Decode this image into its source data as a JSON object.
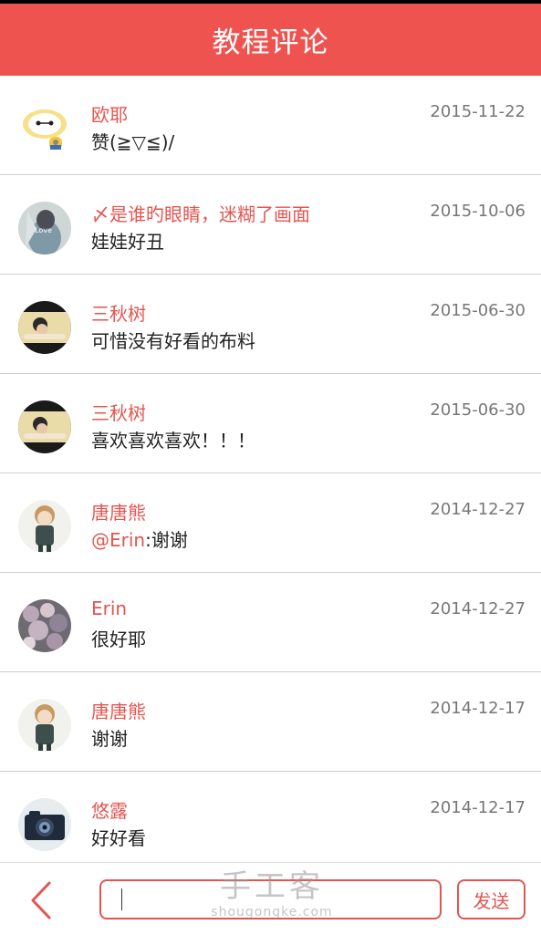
{
  "header": {
    "title": "教程评论"
  },
  "comments": [
    {
      "user": "欧耶",
      "date": "2015-11-22",
      "text": "赞(≧▽≦)/",
      "avatar_icon": "avatar-cartoon-icon"
    },
    {
      "user": "〆是谁旳眼睛，迷糊了画面",
      "date": "2015-10-06",
      "text": "娃娃好丑",
      "avatar_icon": "avatar-photo-icon"
    },
    {
      "user": "三秋树",
      "date": "2015-06-30",
      "text": "可惜没有好看的布料",
      "avatar_icon": "avatar-photo-icon"
    },
    {
      "user": "三秋树",
      "date": "2015-06-30",
      "text": "喜欢喜欢喜欢！！！",
      "avatar_icon": "avatar-photo-icon"
    },
    {
      "user": "唐唐熊",
      "date": "2014-12-27",
      "mention": "@Erin",
      "text": ":谢谢",
      "avatar_icon": "avatar-doll-icon"
    },
    {
      "user": "Erin",
      "date": "2014-12-27",
      "text": "很好耶",
      "avatar_icon": "avatar-flowers-icon"
    },
    {
      "user": "唐唐熊",
      "date": "2014-12-17",
      "text": "谢谢",
      "avatar_icon": "avatar-doll-icon"
    },
    {
      "user": "悠露",
      "date": "2014-12-17",
      "text": "好好看",
      "avatar_icon": "avatar-camera-icon"
    }
  ],
  "input": {
    "value": "",
    "placeholder": ""
  },
  "send_label": "发送",
  "watermark": {
    "main": "手工客",
    "sub": "shougongke.com"
  },
  "colors": {
    "accent": "#ef5350",
    "name_text": "#e4554f",
    "date_text": "#777777",
    "divider": "#cfcfcf"
  }
}
